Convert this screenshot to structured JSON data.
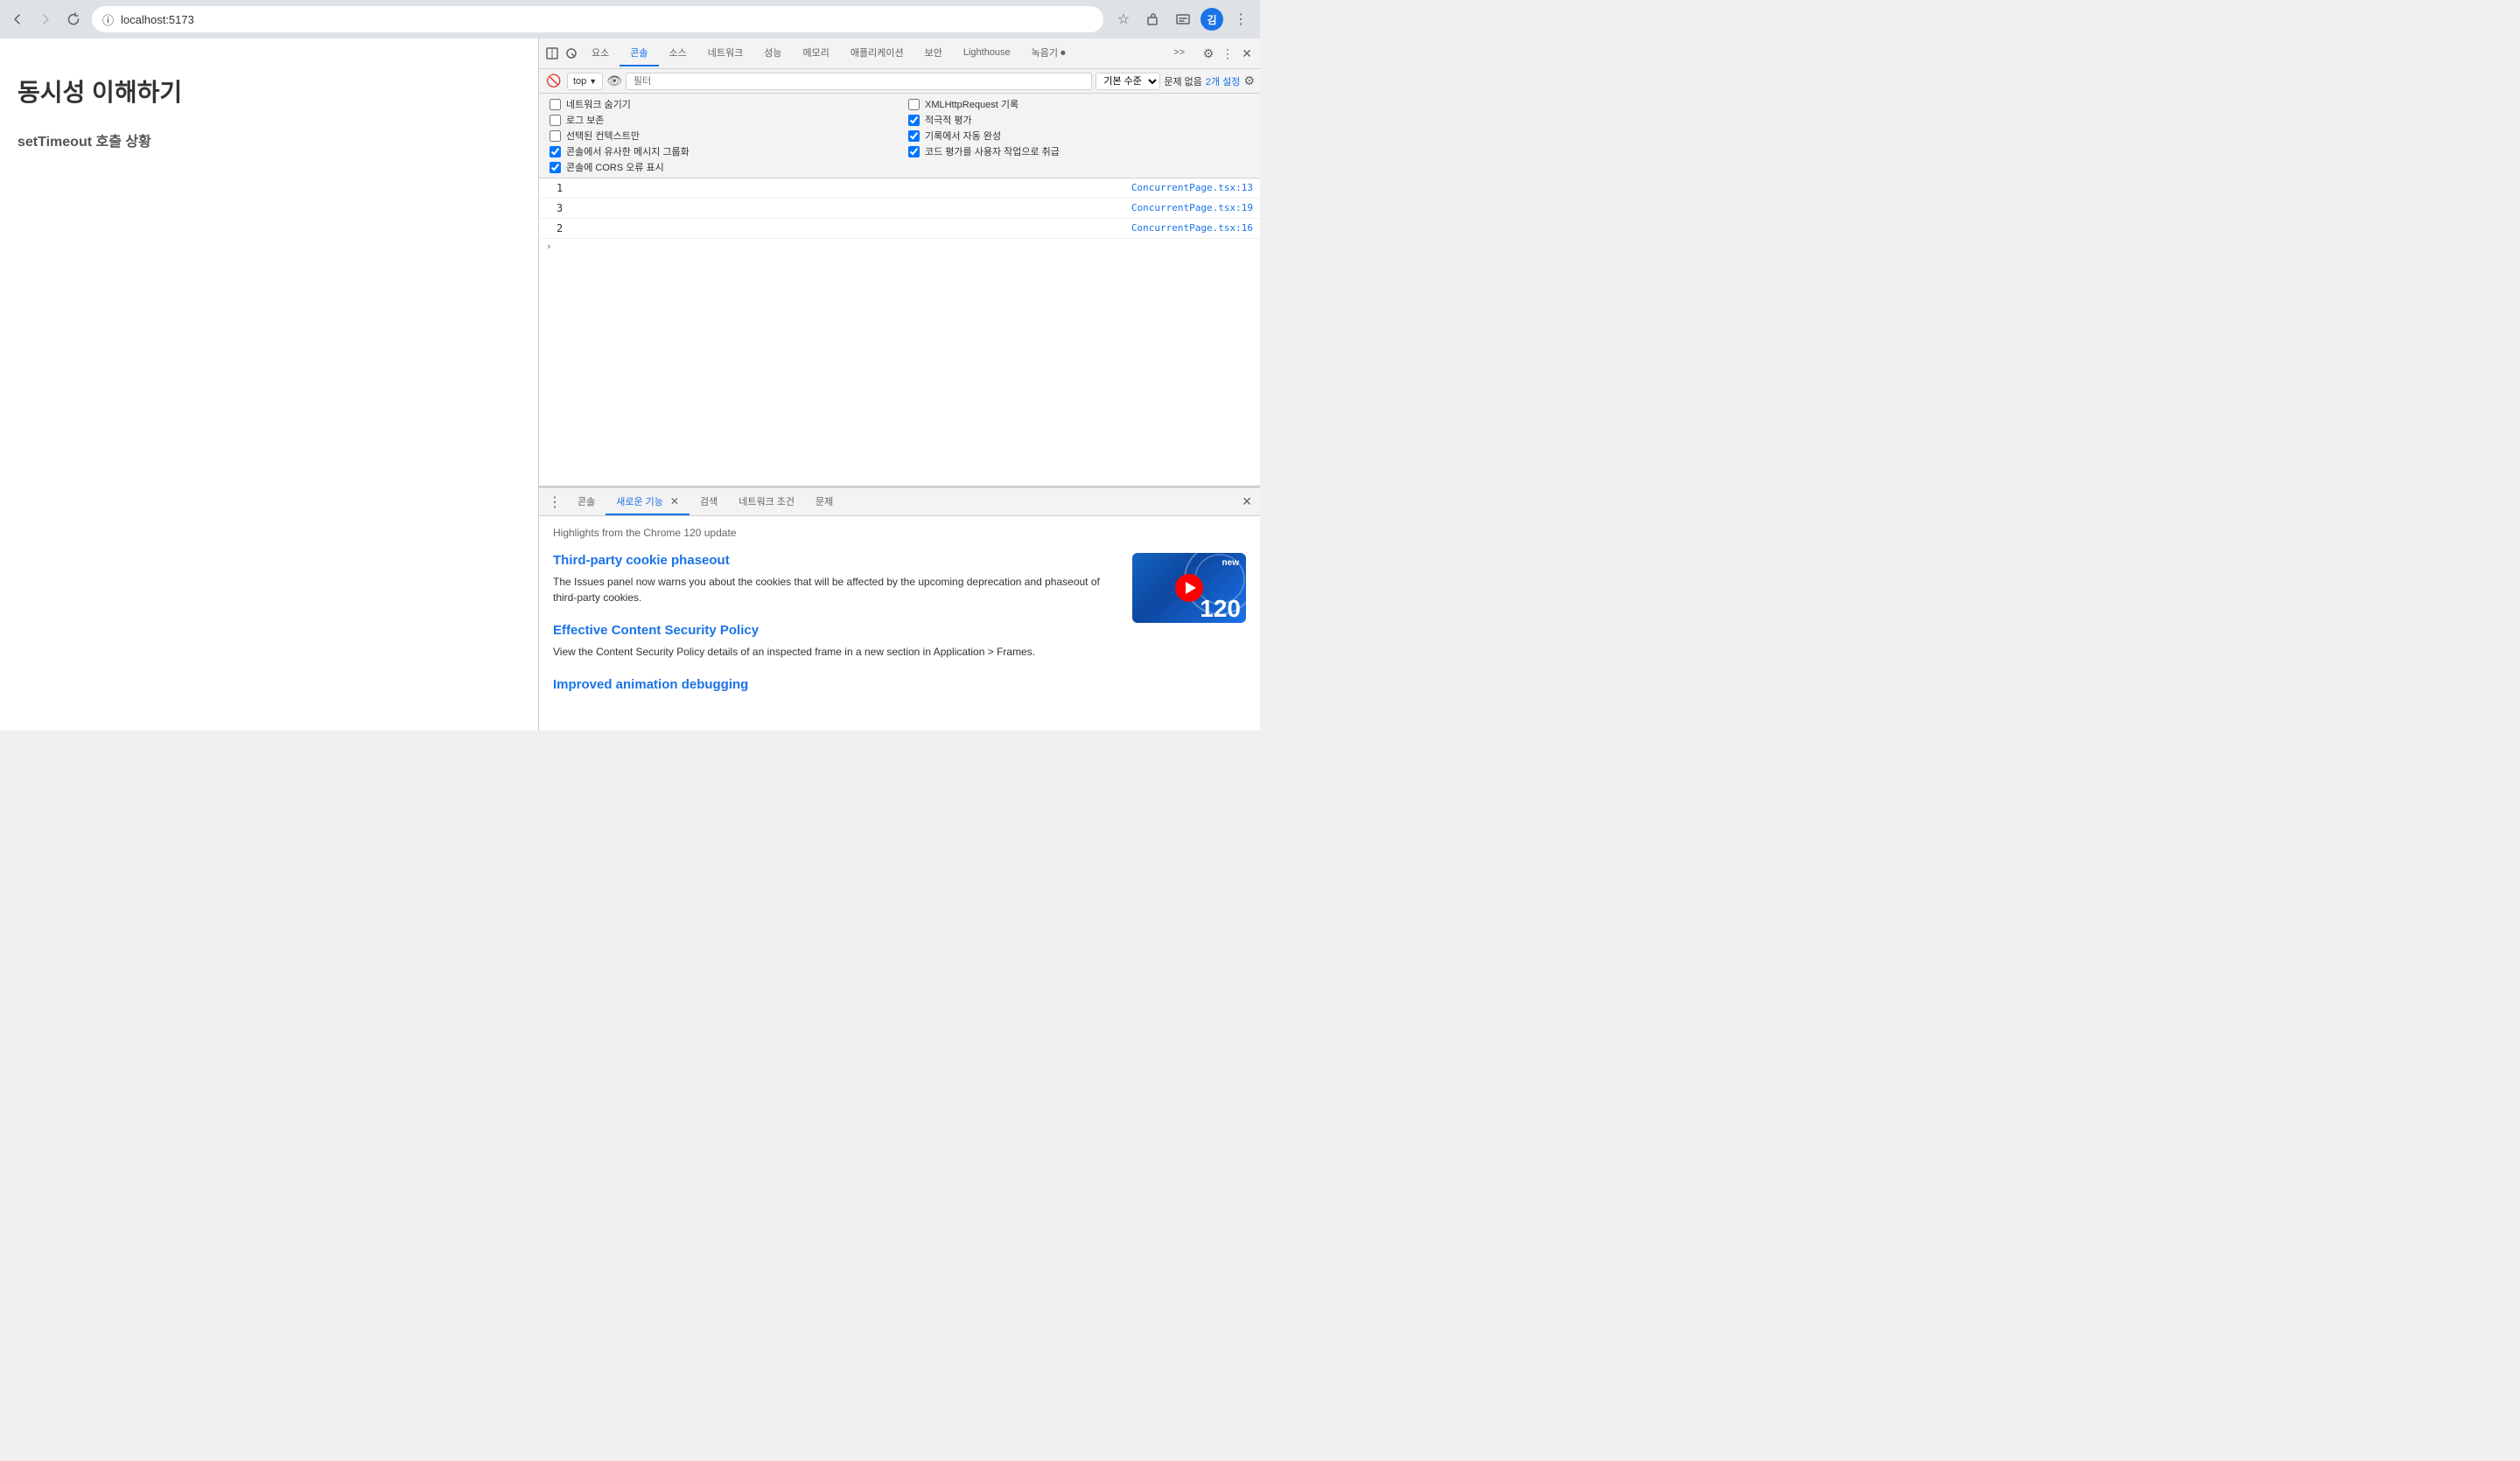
{
  "browser": {
    "url": "localhost:5173",
    "back_disabled": false,
    "forward_disabled": true
  },
  "page": {
    "title": "동시성 이해하기",
    "subtitle": "setTimeout 호출 상황"
  },
  "devtools": {
    "tabs": [
      {
        "id": "elements",
        "label": "요소",
        "active": false
      },
      {
        "id": "console",
        "label": "콘솔",
        "active": true
      },
      {
        "id": "sources",
        "label": "소스",
        "active": false
      },
      {
        "id": "network",
        "label": "네트워크",
        "active": false
      },
      {
        "id": "performance",
        "label": "성능",
        "active": false
      },
      {
        "id": "memory",
        "label": "메모리",
        "active": false
      },
      {
        "id": "application",
        "label": "애플리케이션",
        "active": false
      },
      {
        "id": "security",
        "label": "보안",
        "active": false
      },
      {
        "id": "lighthouse",
        "label": "Lighthouse",
        "active": false
      },
      {
        "id": "recorder",
        "label": "녹음기 ⏺",
        "active": false
      }
    ],
    "more_tabs_label": ">>",
    "console_toolbar": {
      "context": "top",
      "filter_placeholder": "필터",
      "level_label": "기본 수준",
      "issues_label": "문제 없음",
      "issues_count": "2개 설정"
    },
    "options": [
      {
        "label": "네트워크 숨기기",
        "checked": false
      },
      {
        "label": "XMLHttpRequest 기록",
        "checked": false
      },
      {
        "label": "로그 보존",
        "checked": false
      },
      {
        "label": "적극적 평가",
        "checked": true
      },
      {
        "label": "선택된 컨텍스트만",
        "checked": false
      },
      {
        "label": "기록에서 자동 완성",
        "checked": true
      },
      {
        "label": "콘솔에서 유사한 메시지 그룹화",
        "checked": true
      },
      {
        "label": "코드 평가를 사용자 작업으로 취급",
        "checked": true
      },
      {
        "label": "콘솔에 CORS 오류 표시",
        "checked": true
      }
    ],
    "console_entries": [
      {
        "value": "1",
        "link": "ConcurrentPage.tsx:13"
      },
      {
        "value": "3",
        "link": "ConcurrentPage.tsx:19"
      },
      {
        "value": "2",
        "link": "ConcurrentPage.tsx:16"
      }
    ]
  },
  "bottom_panel": {
    "tabs": [
      {
        "id": "console2",
        "label": "콘솔",
        "active": false
      },
      {
        "id": "whatsnew",
        "label": "새로운 기능",
        "active": true,
        "closeable": true
      },
      {
        "id": "search",
        "label": "검색",
        "active": false
      },
      {
        "id": "network-conditions",
        "label": "네트워크 조건",
        "active": false
      },
      {
        "id": "issues",
        "label": "문제",
        "active": false
      }
    ],
    "whatsnew": {
      "header": "Highlights from the Chrome 120 update",
      "features": [
        {
          "id": "cookie-phaseout",
          "title": "Third-party cookie phaseout",
          "description": "The Issues panel now warns you about the cookies that will be affected by the upcoming deprecation and phaseout of third-party cookies."
        },
        {
          "id": "csp",
          "title": "Effective Content Security Policy",
          "description": "View the Content Security Policy details of an inspected frame in a new section in Application > Frames."
        },
        {
          "id": "animation",
          "title": "Improved animation debugging",
          "description": ""
        }
      ],
      "thumbnail": {
        "new_label": "new",
        "version": "120"
      }
    }
  }
}
